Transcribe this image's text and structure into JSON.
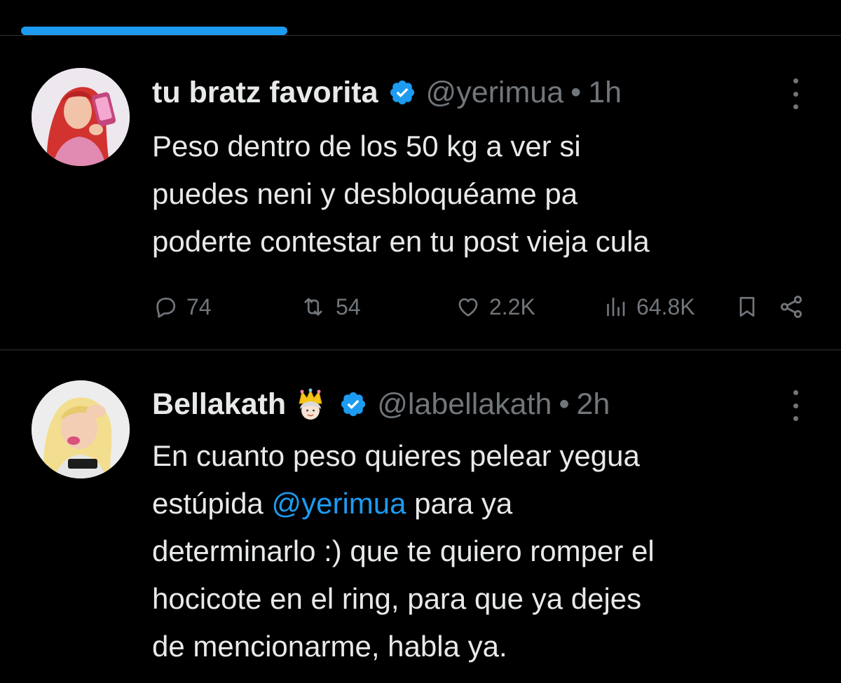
{
  "colors": {
    "background": "#000000",
    "text": "#e7e9ea",
    "muted": "#71767b",
    "accent": "#1d9bf0",
    "divider": "#2f3336"
  },
  "tweets": [
    {
      "display_name": "tu bratz favorita",
      "handle": "@yerimua",
      "dot": "•",
      "time": "1h",
      "verified": true,
      "lines": [
        "Peso dentro de los 50 kg a ver si",
        "puedes neni y desbloquéame pa",
        "poderte contestar en tu post vieja cula"
      ],
      "stats": {
        "replies": "74",
        "reposts": "54",
        "likes": "2.2K",
        "views": "64.8K"
      },
      "icons": [
        "reply-icon",
        "repost-icon",
        "like-icon",
        "views-icon",
        "bookmark-icon",
        "share-icon",
        "more-icon"
      ]
    },
    {
      "display_name": "Bellakath",
      "handle": "@labellakath",
      "dot": "•",
      "time": "2h",
      "verified": true,
      "emoji": "crown-emoji",
      "lines": [
        {
          "before": "En cuanto peso quieres pelear yegua"
        },
        {
          "before": "estúpida ",
          "mention": "@yerimua",
          "after": " para ya"
        },
        {
          "before": "determinarlo :) que te quiero romper el"
        },
        {
          "before": "hocicote en el ring, para que ya dejes"
        },
        {
          "before": "de mencionarme, habla ya."
        }
      ]
    }
  ]
}
